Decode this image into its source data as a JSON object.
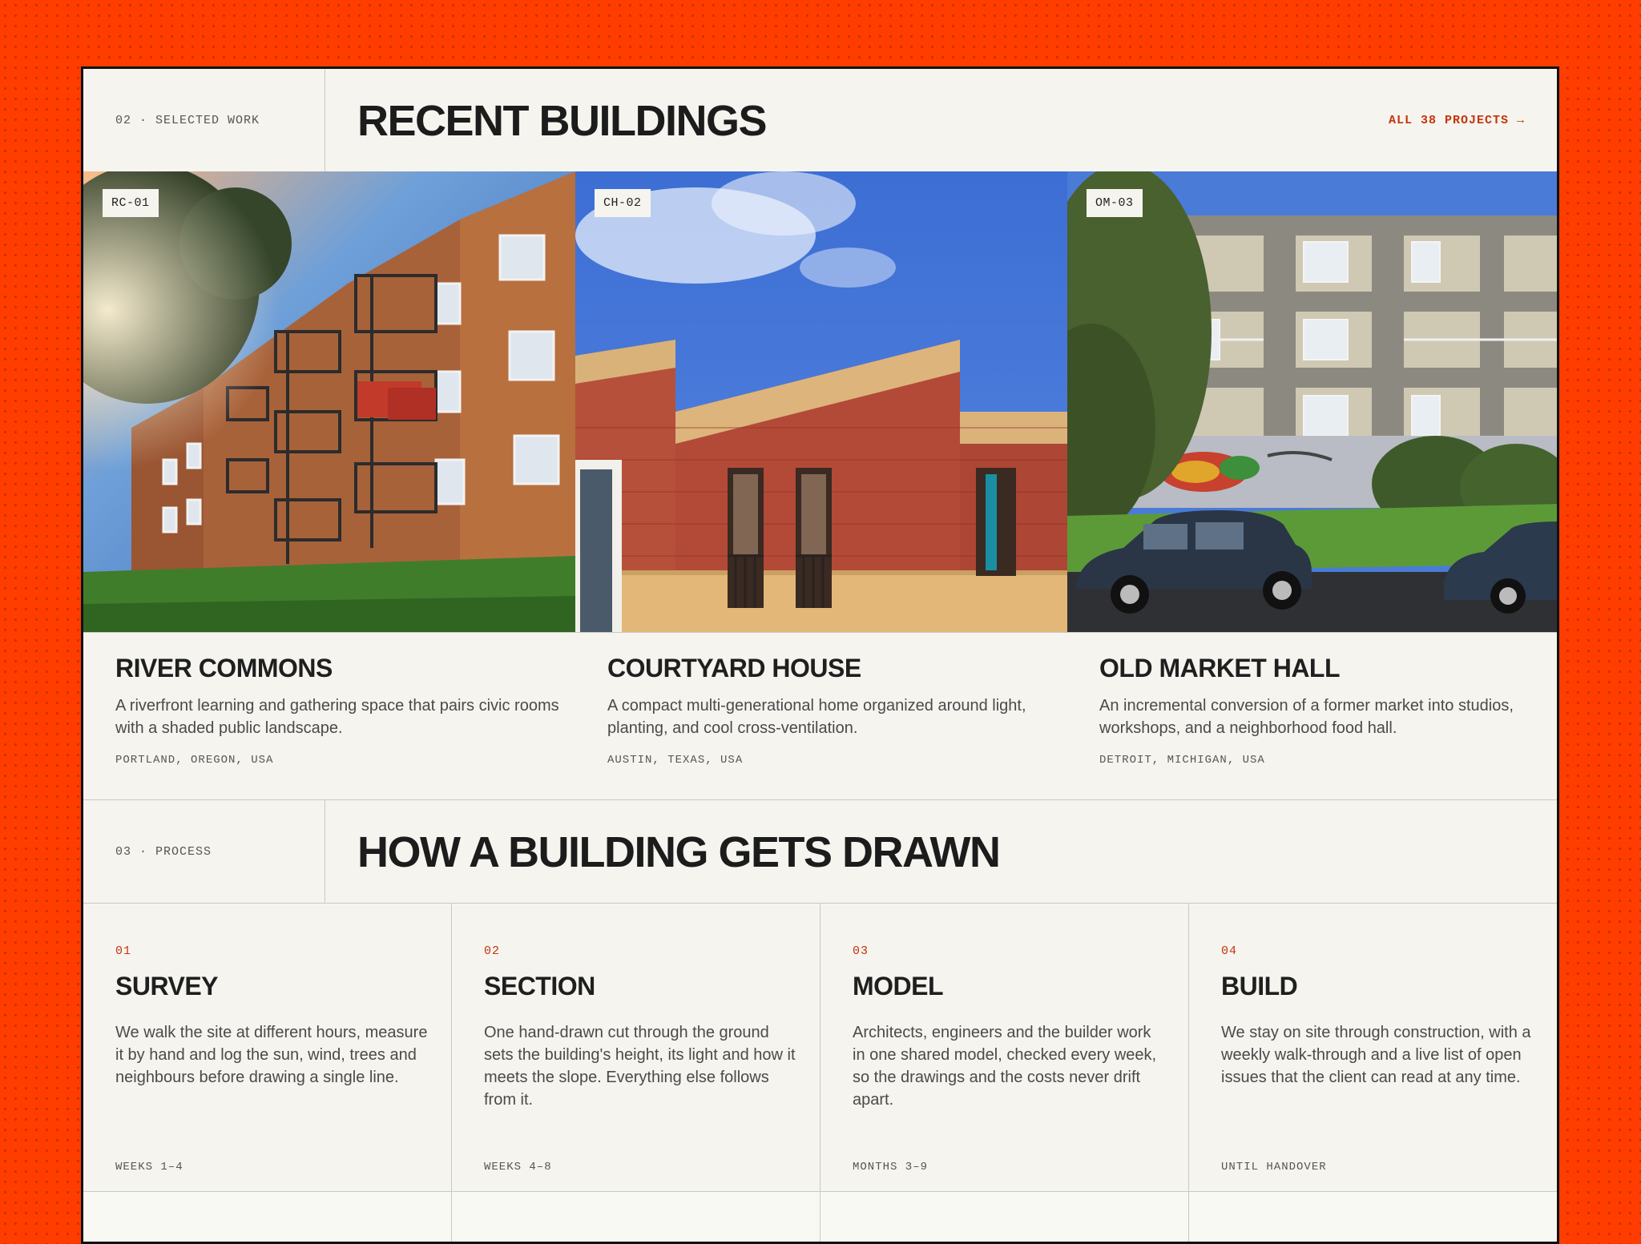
{
  "work": {
    "section_label": "02 · SELECTED WORK",
    "title": "RECENT BUILDINGS",
    "all_link": "ALL 38 PROJECTS →",
    "projects": [
      {
        "tag": "RC-01",
        "name": "RIVER COMMONS",
        "description": "A riverfront learning and gathering space that pairs civic rooms with a shaded public landscape.",
        "location": "PORTLAND, OREGON, USA"
      },
      {
        "tag": "CH-02",
        "name": "COURTYARD HOUSE",
        "description": "A compact multi-generational home organized around light, planting, and cool cross-ventilation.",
        "location": "AUSTIN, TEXAS, USA"
      },
      {
        "tag": "OM-03",
        "name": "OLD MARKET HALL",
        "description": "An incremental conversion of a former market into studios, workshops, and a neighborhood food hall.",
        "location": "DETROIT, MICHIGAN, USA"
      }
    ]
  },
  "process": {
    "section_label": "03 · PROCESS",
    "title": "HOW A BUILDING GETS DRAWN",
    "steps": [
      {
        "number": "01",
        "title": "SURVEY",
        "description": "We walk the site at different hours, measure it by hand and log the sun, wind, trees and neighbours before drawing a single line.",
        "duration": "WEEKS 1–4"
      },
      {
        "number": "02",
        "title": "SECTION",
        "description": "One hand-drawn cut through the ground sets the building's height, its light and how it meets the slope. Everything else follows from it.",
        "duration": "WEEKS 4–8"
      },
      {
        "number": "03",
        "title": "MODEL",
        "description": "Architects, engineers and the builder work in one shared model, checked every week, so the drawings and the costs never drift apart.",
        "duration": "MONTHS 3–9"
      },
      {
        "number": "04",
        "title": "BUILD",
        "description": "We stay on site through construction, with a weekly walk-through and a live list of open issues that the client can read at any time.",
        "duration": "UNTIL HANDOVER"
      }
    ]
  },
  "colors": {
    "accent": "#c4340c",
    "background": "#ff3d00",
    "paper": "#f5f4ef"
  }
}
